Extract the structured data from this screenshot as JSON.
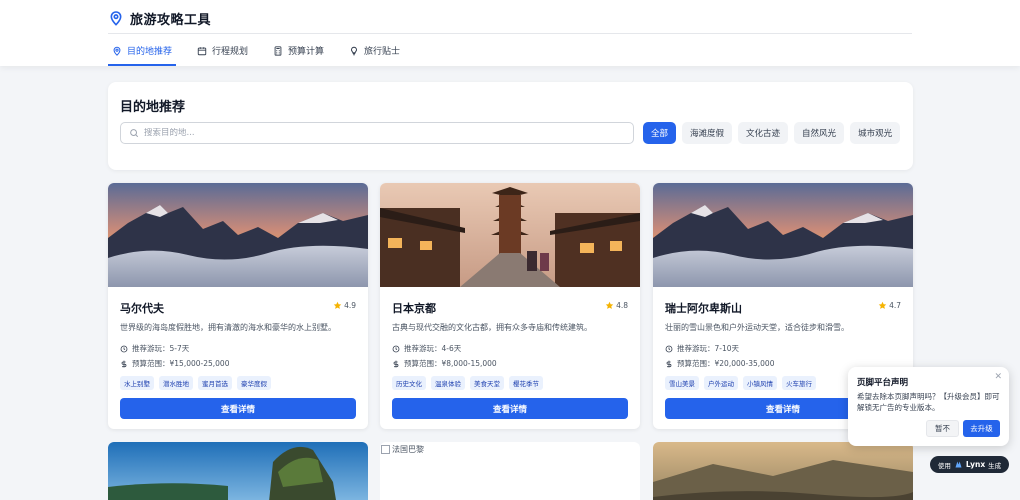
{
  "header": {
    "title": "旅游攻略工具",
    "tabs": [
      {
        "label": "目的地推荐",
        "icon": "map-pin-icon",
        "active": true
      },
      {
        "label": "行程规划",
        "icon": "calendar-icon",
        "active": false
      },
      {
        "label": "预算计算",
        "icon": "calculator-icon",
        "active": false
      },
      {
        "label": "旅行贴士",
        "icon": "lightbulb-icon",
        "active": false
      }
    ]
  },
  "search": {
    "title": "目的地推荐",
    "placeholder": "搜索目的地...",
    "filters": [
      "全部",
      "海滩度假",
      "文化古迹",
      "自然风光",
      "城市观光"
    ],
    "active_filter": "全部"
  },
  "destinations": [
    {
      "name": "马尔代夫",
      "rating": "4.9",
      "description": "世界级的海岛度假胜地，拥有清澈的海水和豪华的水上别墅。",
      "duration": "推荐游玩：5-7天",
      "budget": "预算范围：¥15,000-25,000",
      "tags": [
        "水上别墅",
        "潜水胜地",
        "蜜月首选",
        "豪华度假"
      ],
      "button": "查看详情"
    },
    {
      "name": "日本京都",
      "rating": "4.8",
      "description": "古典与现代交融的文化古都，拥有众多寺庙和传统建筑。",
      "duration": "推荐游玩：4-6天",
      "budget": "预算范围：¥8,000-15,000",
      "tags": [
        "历史文化",
        "温泉体验",
        "美食天堂",
        "樱花季节"
      ],
      "button": "查看详情"
    },
    {
      "name": "瑞士阿尔卑斯山",
      "rating": "4.7",
      "description": "壮丽的雪山景色和户外运动天堂，适合徒步和滑雪。",
      "duration": "推荐游玩：7-10天",
      "budget": "预算范围：¥20,000-35,000",
      "tags": [
        "雪山美景",
        "户外运动",
        "小镇风情",
        "火车旅行"
      ],
      "button": "查看详情"
    }
  ],
  "second_row": {
    "broken_image_alt": "法国巴黎"
  },
  "popup": {
    "title": "页脚平台声明",
    "text": "希望去除本页脚声明吗？【升级会员】即可解锁无广告的专业版本。",
    "later": "暂不",
    "upgrade": "去升级"
  },
  "badge": {
    "prefix": "使用",
    "brand": "Lynx",
    "suffix": "生成"
  },
  "colors": {
    "primary": "#2563eb",
    "tag_bg": "#eaf1fd",
    "star": "#f5b301"
  }
}
